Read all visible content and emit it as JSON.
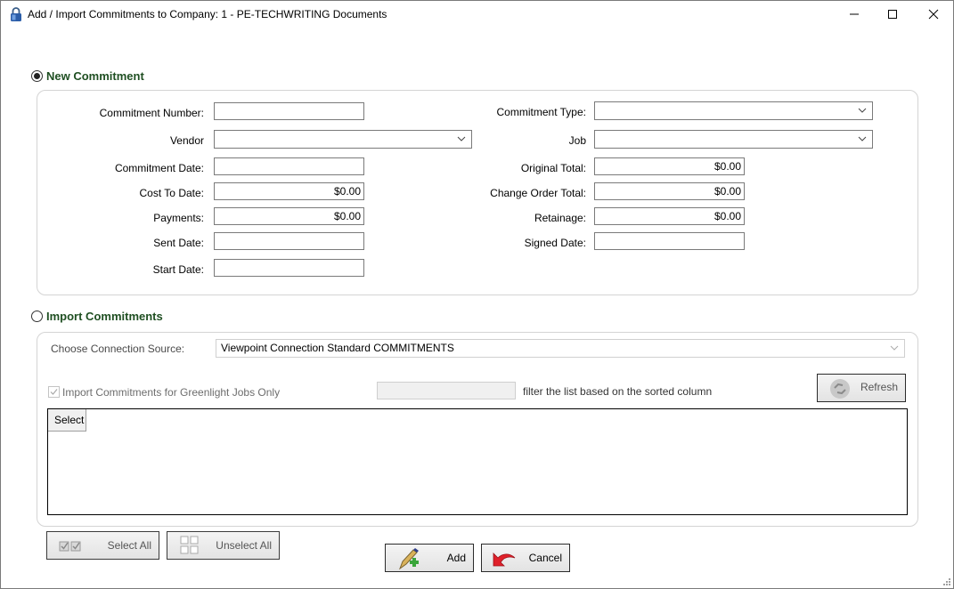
{
  "window": {
    "title": "Add / Import Commitments to Company: 1 - PE-TECHWRITING Documents",
    "icon": "lock-icon",
    "controls": [
      "minimize",
      "maximize",
      "close"
    ]
  },
  "new_commitment": {
    "radio_label": "New Commitment",
    "selected": true,
    "left_fields": [
      {
        "label": "Commitment Number:",
        "value": "",
        "type": "text"
      },
      {
        "label": "Vendor",
        "value": "",
        "type": "combo"
      },
      {
        "label": "Commitment Date:",
        "value": "",
        "type": "text"
      },
      {
        "label": "Cost To Date:",
        "value": "$0.00",
        "type": "text"
      },
      {
        "label": "Payments:",
        "value": "$0.00",
        "type": "text"
      },
      {
        "label": "Sent Date:",
        "value": "",
        "type": "text"
      },
      {
        "label": "Start Date:",
        "value": "",
        "type": "text"
      }
    ],
    "right_fields": [
      {
        "label": "Commitment Type:",
        "value": "",
        "type": "combo"
      },
      {
        "label": "Job",
        "value": "",
        "type": "combo"
      },
      {
        "label": "Original Total:",
        "value": "$0.00",
        "type": "text"
      },
      {
        "label": "Change Order Total:",
        "value": "$0.00",
        "type": "text"
      },
      {
        "label": "Retainage:",
        "value": "$0.00",
        "type": "text"
      },
      {
        "label": "Signed Date:",
        "value": "",
        "type": "text"
      }
    ]
  },
  "import_commitments": {
    "radio_label": "Import Commitments",
    "selected": false,
    "connection_source_label": "Choose Connection Source:",
    "connection_source_value": "Viewpoint Connection Standard COMMITMENTS",
    "greenlight_checkbox_label": "Import Commitments for Greenlight Jobs Only",
    "greenlight_checked": true,
    "filter_value": "",
    "filter_hint": "filter the list based on the sorted column",
    "refresh_label": "Refresh",
    "grid_columns": [
      "Select"
    ],
    "grid_rows": []
  },
  "footer": {
    "select_all_label": "Select All",
    "unselect_all_label": "Unselect All",
    "add_label": "Add",
    "cancel_label": "Cancel"
  }
}
